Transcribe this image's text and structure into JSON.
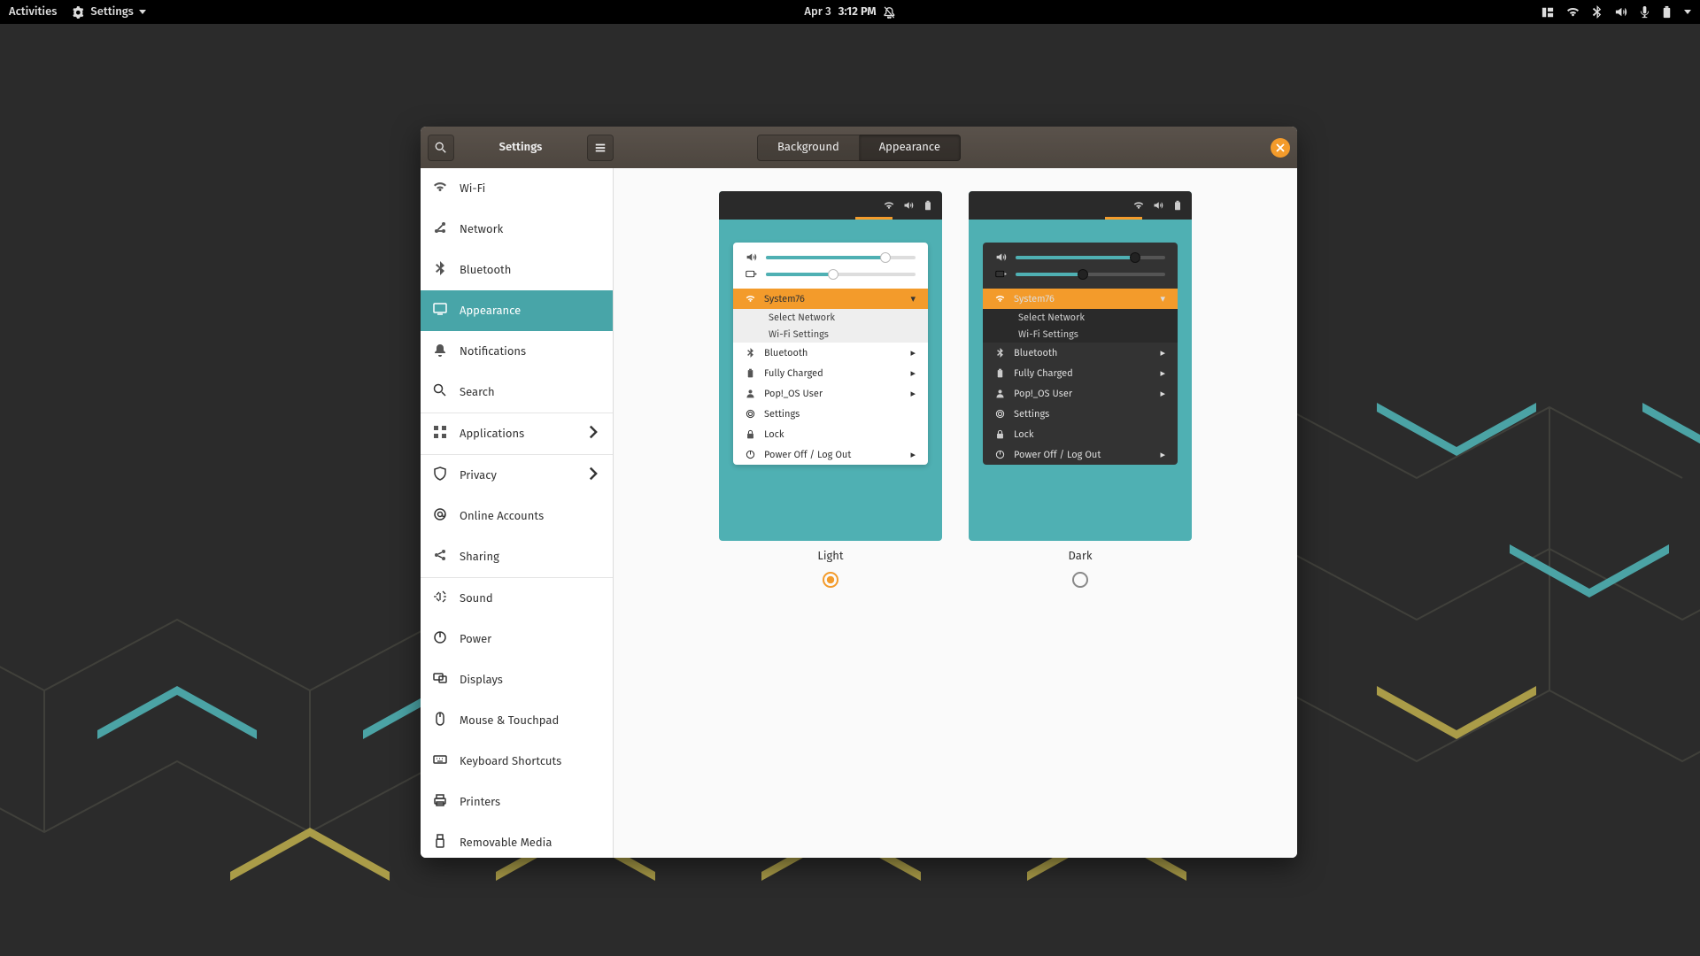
{
  "topbar": {
    "activities": "Activities",
    "app_name": "Settings",
    "date": "Apr 3",
    "time": "3:12 PM"
  },
  "window": {
    "title": "Settings",
    "tabs": {
      "background": "Background",
      "appearance": "Appearance"
    },
    "active_tab": "appearance"
  },
  "sidebar": {
    "items": [
      {
        "id": "wi-fi",
        "label": "Wi-Fi",
        "icon": "wifi"
      },
      {
        "id": "network",
        "label": "Network",
        "icon": "network"
      },
      {
        "id": "bluetooth",
        "label": "Bluetooth",
        "icon": "bt"
      },
      {
        "id": "appearance",
        "label": "Appearance",
        "icon": "display",
        "active": true
      },
      {
        "id": "notifications",
        "label": "Notifications",
        "icon": "bell"
      },
      {
        "id": "search",
        "label": "Search",
        "icon": "search"
      },
      {
        "sep": true
      },
      {
        "id": "applications",
        "label": "Applications",
        "icon": "apps",
        "chevron": true
      },
      {
        "sep": true
      },
      {
        "id": "privacy",
        "label": "Privacy",
        "icon": "shield",
        "chevron": true
      },
      {
        "id": "online-accounts",
        "label": "Online Accounts",
        "icon": "at"
      },
      {
        "id": "sharing",
        "label": "Sharing",
        "icon": "share"
      },
      {
        "sep": true
      },
      {
        "id": "sound",
        "label": "Sound",
        "icon": "sound"
      },
      {
        "id": "power",
        "label": "Power",
        "icon": "power"
      },
      {
        "id": "displays",
        "label": "Displays",
        "icon": "displays"
      },
      {
        "id": "mouse",
        "label": "Mouse & Touchpad",
        "icon": "mouse"
      },
      {
        "id": "keyboard",
        "label": "Keyboard Shortcuts",
        "icon": "kbd"
      },
      {
        "id": "printers",
        "label": "Printers",
        "icon": "printer"
      },
      {
        "id": "removable",
        "label": "Removable Media",
        "icon": "usb"
      }
    ]
  },
  "preview_menu": {
    "network_name": "System76",
    "select_network": "Select Network",
    "wifi_settings": "Wi-Fi Settings",
    "bluetooth": "Bluetooth",
    "battery": "Fully Charged",
    "user": "Pop!_OS User",
    "settings": "Settings",
    "lock": "Lock",
    "power": "Power Off / Log Out"
  },
  "themes": {
    "light": "Light",
    "dark": "Dark",
    "selected": "light"
  },
  "colors": {
    "accent": "#4fb0b3",
    "highlight": "#f39b2b"
  }
}
